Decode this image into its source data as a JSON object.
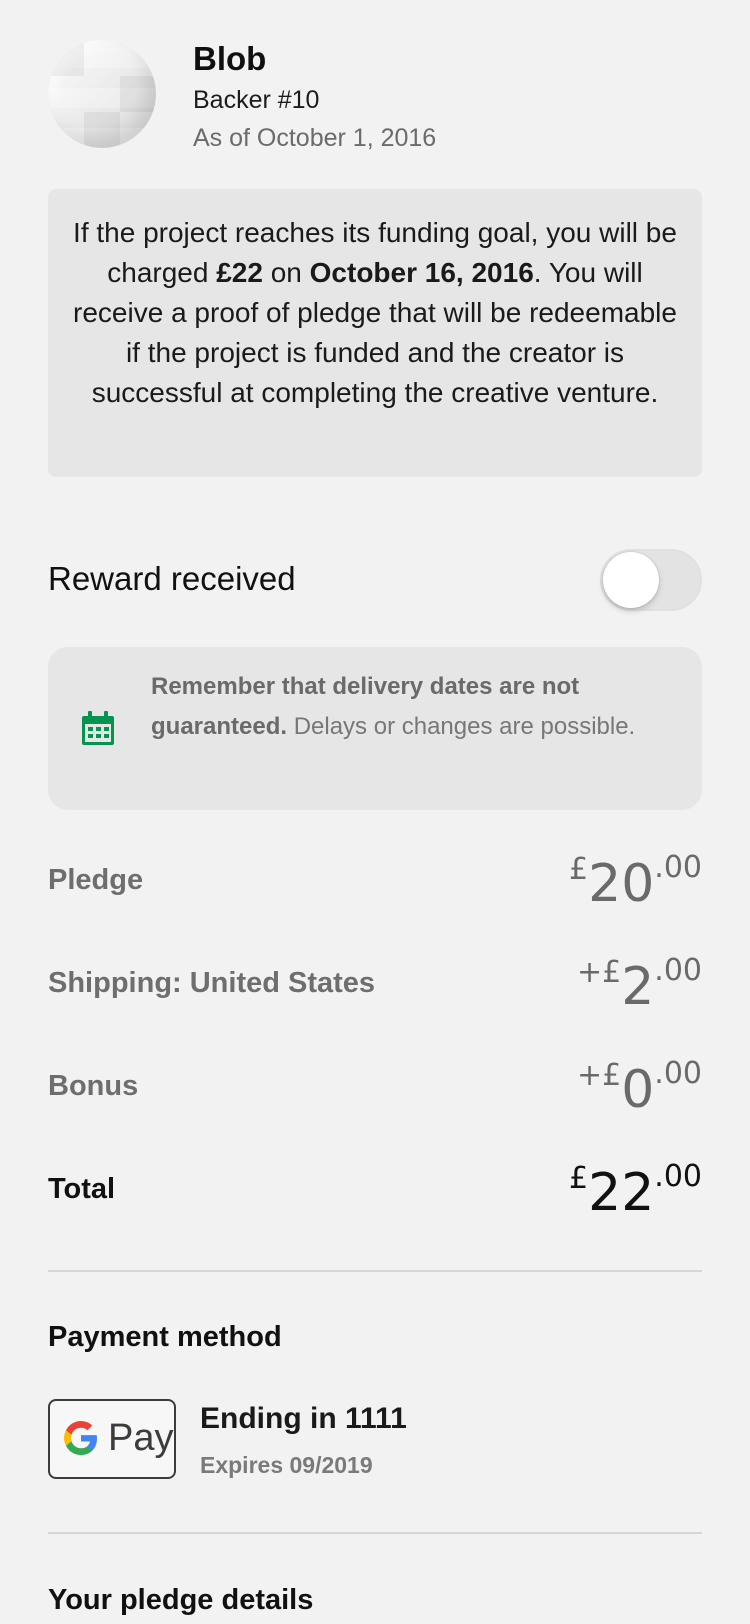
{
  "header": {
    "name": "Blob",
    "backer": "Backer #10",
    "as_of": "As of October 1, 2016"
  },
  "info": {
    "part1": "If the project reaches its funding goal, you will be charged ",
    "amount": "£22",
    "part2": " on ",
    "date": "October 16, 2016",
    "part3": ". You will receive a proof of pledge that will be redeemable if the project is funded and the creator is successful at completing the creative venture."
  },
  "reward": {
    "label": "Reward received",
    "toggle_on": false
  },
  "delivery_note": {
    "icon": "calendar-icon",
    "bold": "Remember that delivery dates are not guaranteed.",
    "rest": " Delays or changes are possible."
  },
  "amounts": {
    "pledge": {
      "label": "Pledge",
      "prefix": "£",
      "whole": "20",
      "decimal": ".00"
    },
    "shipping": {
      "label": "Shipping: United States",
      "prefix": "+£",
      "whole": "2",
      "decimal": ".00"
    },
    "bonus": {
      "label": "Bonus",
      "prefix": "+£",
      "whole": "0",
      "decimal": ".00"
    },
    "total": {
      "label": "Total",
      "prefix": "£",
      "whole": "22",
      "decimal": ".00"
    }
  },
  "payment": {
    "title": "Payment method",
    "provider_logo": "google-pay-logo",
    "pay_text": "Pay",
    "ending": "Ending in 1111",
    "expires": "Expires 09/2019"
  },
  "pledge_details": {
    "title": "Your pledge details"
  },
  "colors": {
    "background": "#f2f2f2",
    "panel": "#e6e6e6",
    "calendar_green": "#05944f"
  }
}
